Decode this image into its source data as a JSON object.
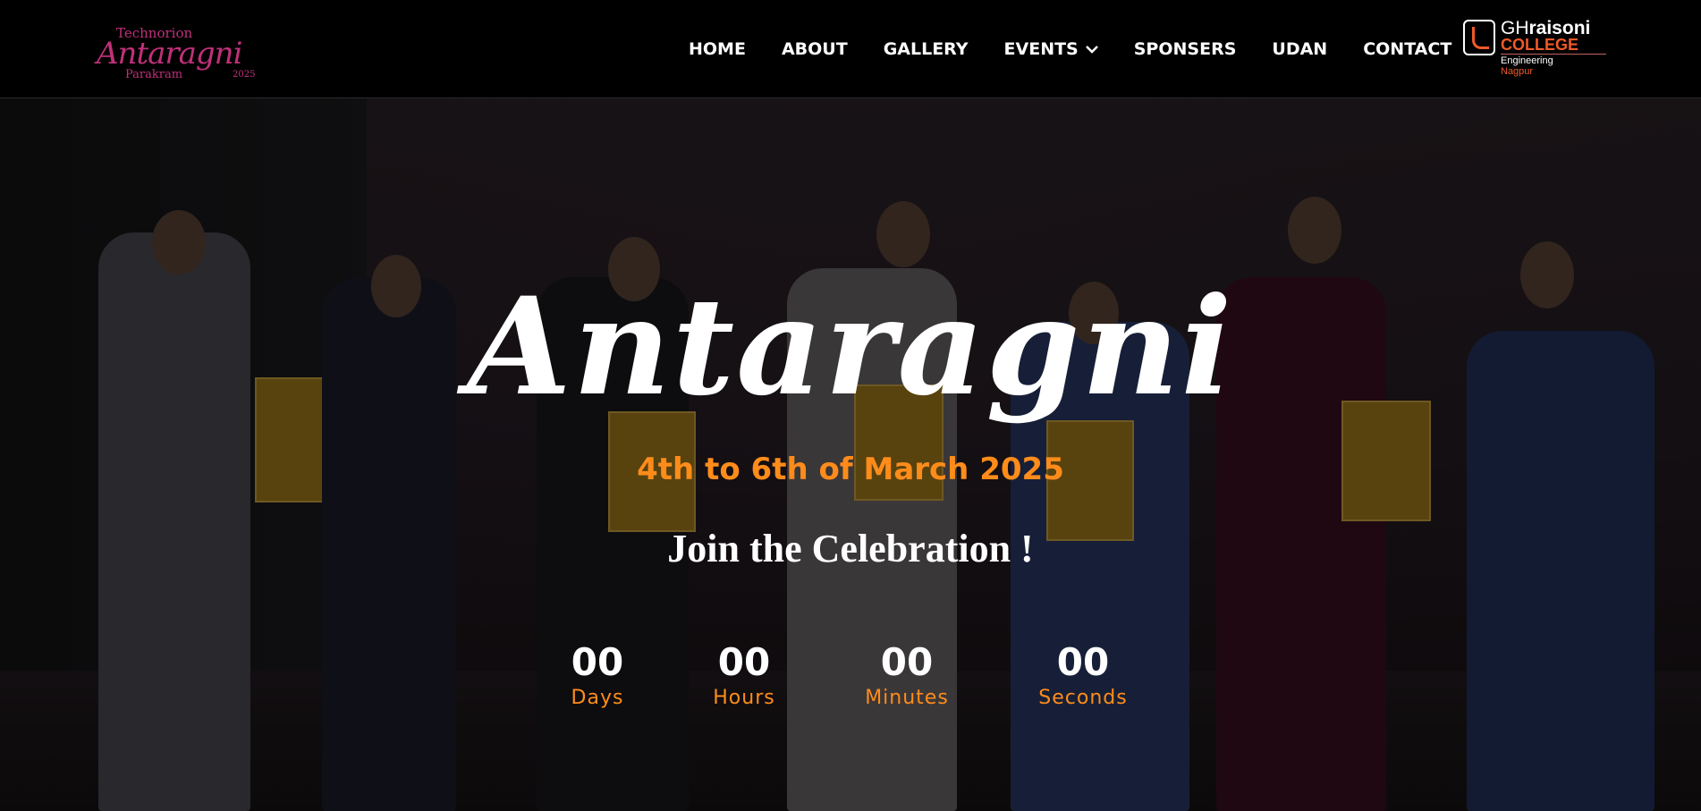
{
  "navbar": {
    "brand": {
      "tech": "Technorion",
      "main": "Antaragni",
      "sub": "Parakram",
      "year": "2025"
    },
    "items": [
      {
        "label": "HOME"
      },
      {
        "label": "ABOUT"
      },
      {
        "label": "GALLERY"
      },
      {
        "label": "EVENTS",
        "has_dropdown": true,
        "icon": "chevron-down-icon"
      },
      {
        "label": "SPONSERS"
      },
      {
        "label": "UDAN"
      },
      {
        "label": "CONTACT"
      }
    ],
    "college_logo": {
      "gh": "GH",
      "raisoni": "raisoni",
      "college": "COLLEGE",
      "line1": "Engineering",
      "line2": "Nagpur"
    }
  },
  "hero": {
    "title": "Antaragni",
    "dates": "4th to 6th of March 2025",
    "cta": "Join the Celebration !",
    "colors": {
      "accent": "#ff8c1a",
      "brand": "#c0307a",
      "college": "#f05a28"
    }
  },
  "countdown": [
    {
      "value": "00",
      "label": "Days"
    },
    {
      "value": "00",
      "label": "Hours"
    },
    {
      "value": "00",
      "label": "Minutes"
    },
    {
      "value": "00",
      "label": "Seconds"
    }
  ]
}
